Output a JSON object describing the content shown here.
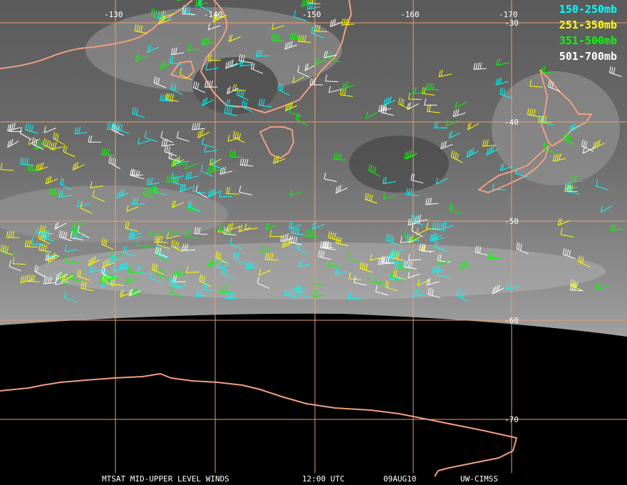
{
  "product": {
    "footer_title": "MTSAT MID-UPPER LEVEL WINDS",
    "footer_time": "12:00 UTC",
    "footer_date": "09AUG10",
    "footer_credit": "UW-CIMSS"
  },
  "legend": [
    {
      "label": "150-250mb",
      "color": "#00ffff"
    },
    {
      "label": "251-350mb",
      "color": "#ffff00"
    },
    {
      "label": "351-500mb",
      "color": "#00ff00"
    },
    {
      "label": "501-700mb",
      "color": "#ffffff"
    }
  ],
  "longitude_labels": [
    "-130",
    "-140",
    "-150",
    "-160",
    "-170"
  ],
  "latitude_labels": [
    "-30",
    "-40",
    "-50",
    "-60",
    "-70"
  ],
  "colors": {
    "grid": "#e8a070",
    "coast": "#f0a080",
    "background": "#000000",
    "cloud": "#808080"
  }
}
